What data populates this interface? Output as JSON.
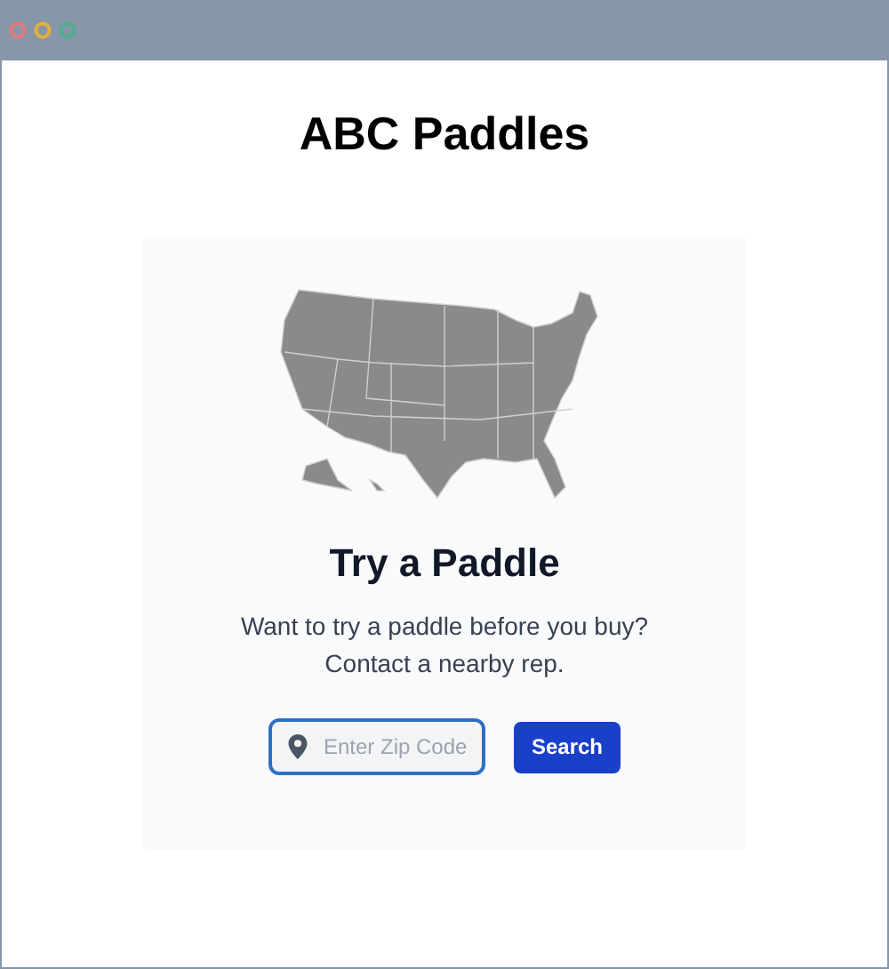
{
  "page": {
    "title": "ABC Paddles"
  },
  "card": {
    "heading": "Try a Paddle",
    "description_lines": [
      "Want to try a paddle before you buy?",
      "Contact a nearby rep."
    ]
  },
  "search": {
    "placeholder": "Enter Zip Code",
    "button": "Search"
  }
}
